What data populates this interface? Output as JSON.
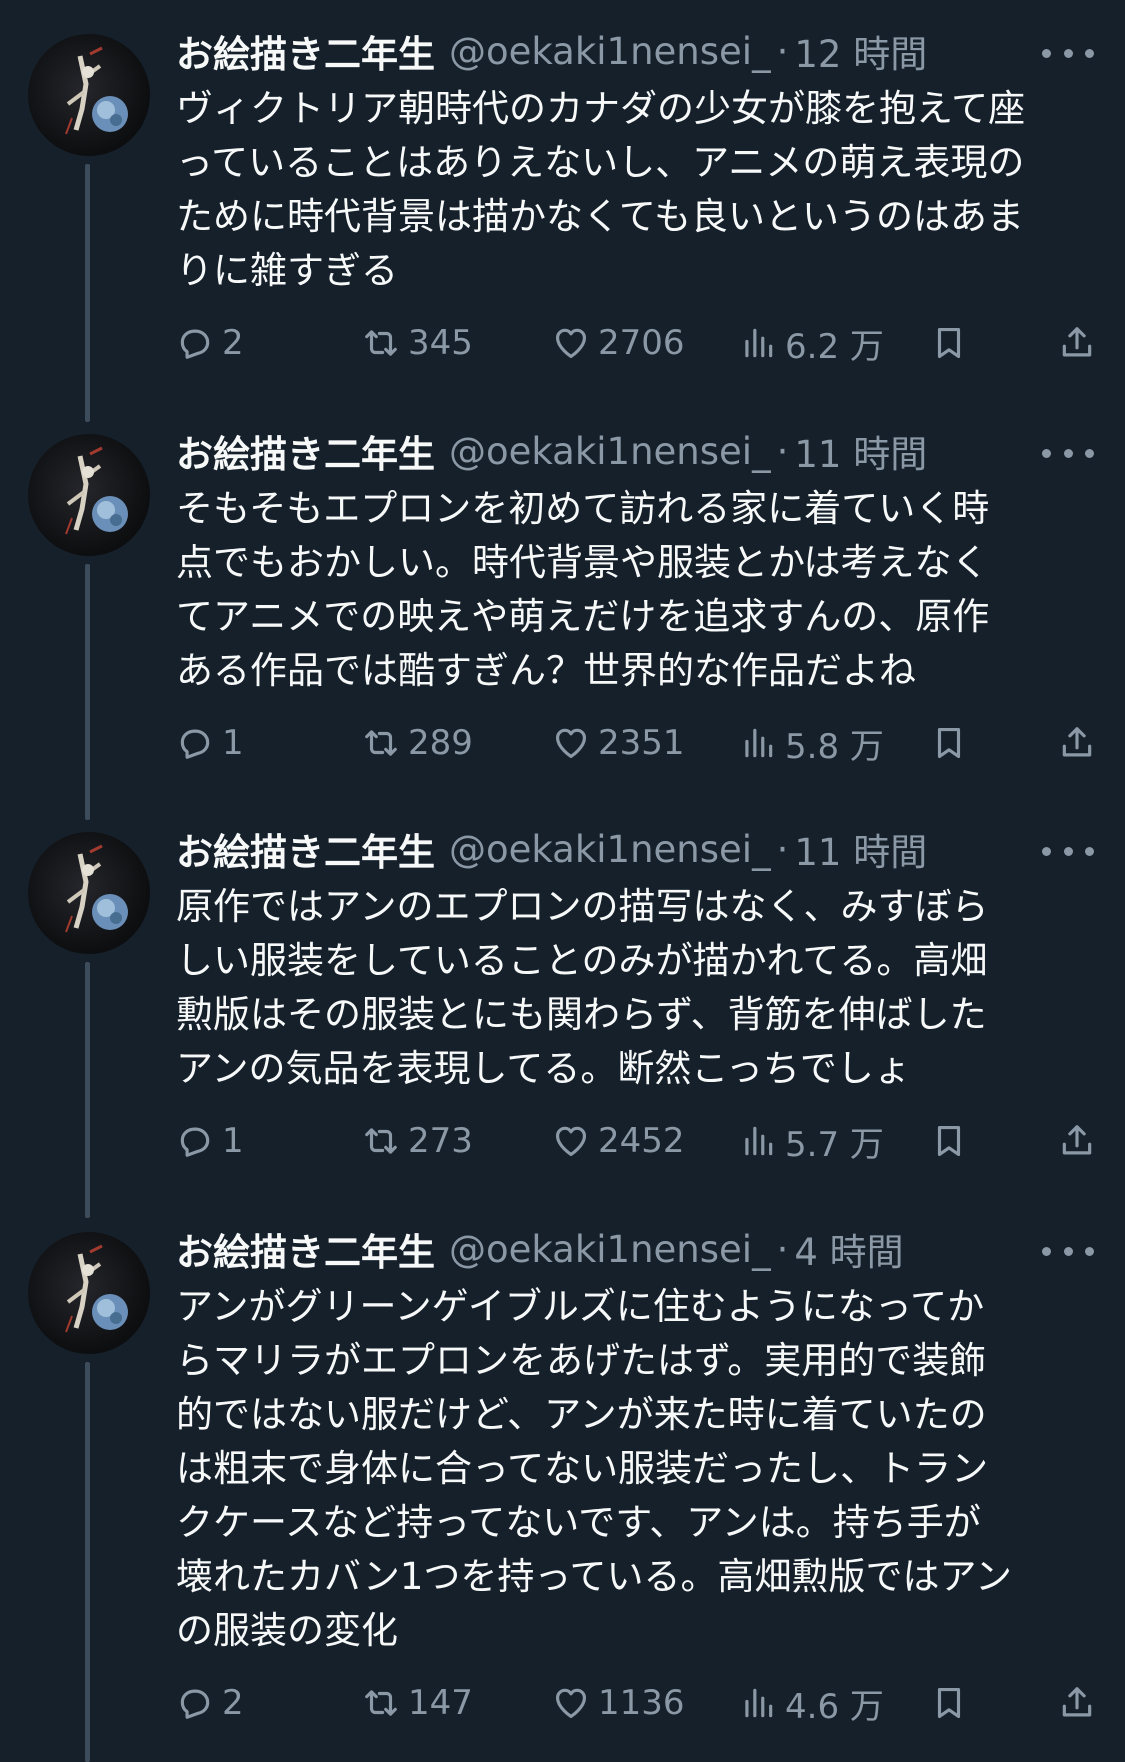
{
  "tweets": [
    {
      "name": "お絵描き二年生",
      "handle": "@oekaki1nensei_",
      "separator": "·",
      "time": "12 時間",
      "text": "ヴィクトリア朝時代のカナダの少女が膝を抱えて座\nっていることはありえないし、アニメの萌え表現の\nために時代背景は描かなくても良いというのはあま\nりに雑すぎる",
      "replies": "2",
      "retweets": "345",
      "likes": "2706",
      "views": "6.2 万"
    },
    {
      "name": "お絵描き二年生",
      "handle": "@oekaki1nensei_",
      "separator": "·",
      "time": "11 時間",
      "text": "そもそもエプロンを初めて訪れる家に着ていく時\n点でもおかしい。時代背景や服装とかは考えなく\nてアニメでの映えや萌えだけを追求すんの、原作\nある作品では酷すぎん？世界的な作品だよね",
      "replies": "1",
      "retweets": "289",
      "likes": "2351",
      "views": "5.8 万"
    },
    {
      "name": "お絵描き二年生",
      "handle": "@oekaki1nensei_",
      "separator": "·",
      "time": "11 時間",
      "text": "原作ではアンのエプロンの描写はなく、みすぼら\nしい服装をしていることのみが描かれてる。高畑\n勲版はその服装とにも関わらず、背筋を伸ばした\nアンの気品を表現してる。断然こっちでしょ",
      "replies": "1",
      "retweets": "273",
      "likes": "2452",
      "views": "5.7 万"
    },
    {
      "name": "お絵描き二年生",
      "handle": "@oekaki1nensei_",
      "separator": "·",
      "time": "4 時間",
      "text": "アンがグリーンゲイブルズに住むようになってか\nらマリラがエプロンをあげたはず。実用的で装飾\n的ではない服だけど、アンが来た時に着ていたの\nは粗末で身体に合ってない服装だったし、トラン\nクケースなど持ってないです、アンは。持ち手が\n壊れたカバン1つを持っている。高畑勲版ではアン\nの服装の変化",
      "replies": "2",
      "retweets": "147",
      "likes": "1136",
      "views": "4.6 万"
    }
  ],
  "colors": {
    "background": "#15202b",
    "text": "#f7f9f9",
    "secondary": "#8b98a5",
    "thread_line": "#3d4c5b"
  },
  "icons": [
    "reply-icon",
    "retweet-icon",
    "like-icon",
    "views-icon",
    "bookmark-icon",
    "share-icon",
    "more-icon"
  ]
}
